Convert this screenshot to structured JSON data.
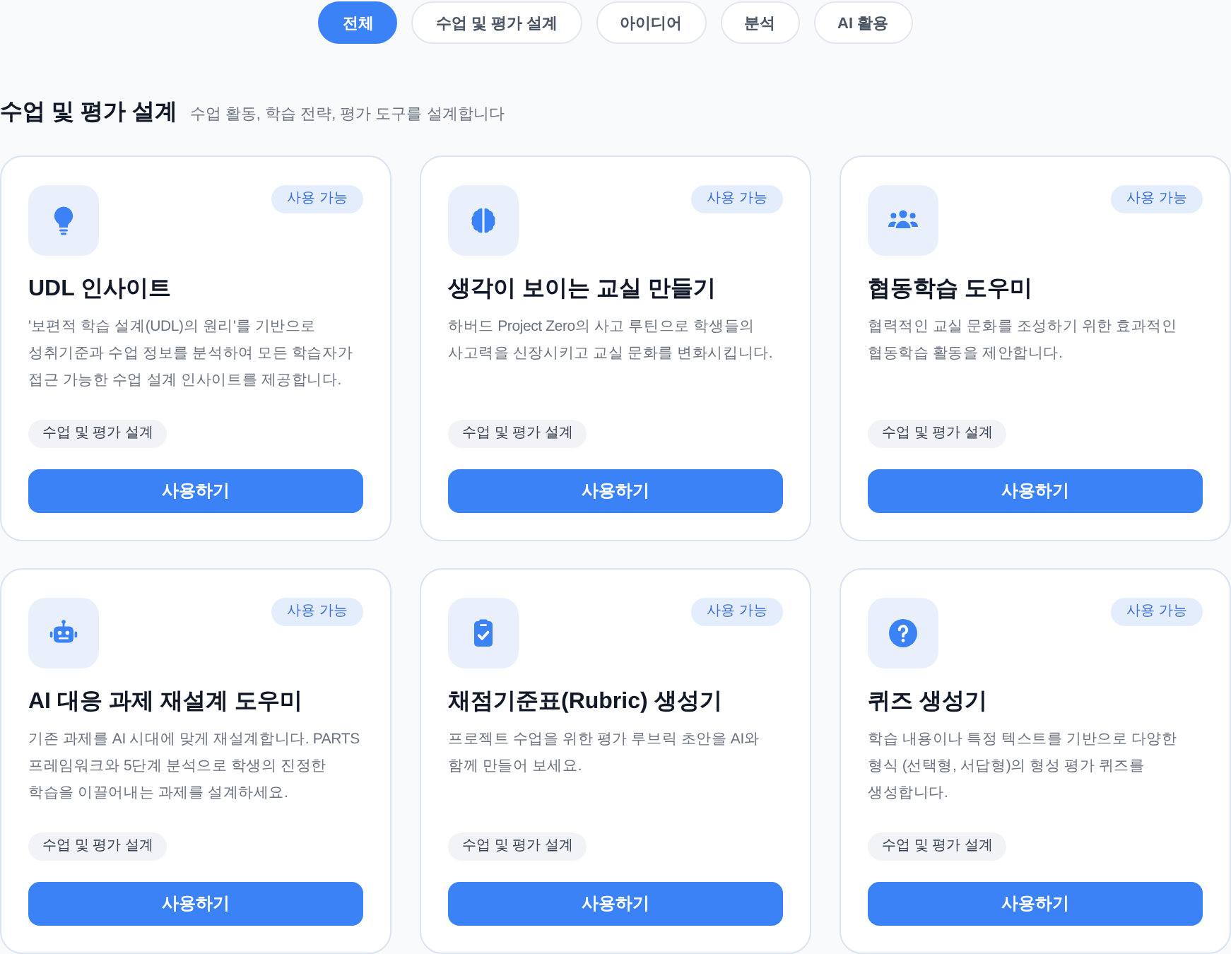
{
  "filter_tabs": [
    {
      "label": "전체",
      "selected": true
    },
    {
      "label": "수업 및 평가 설계",
      "selected": false
    },
    {
      "label": "아이디어",
      "selected": false
    },
    {
      "label": "분석",
      "selected": false
    },
    {
      "label": "AI 활용",
      "selected": false
    }
  ],
  "section": {
    "title": "수업 및 평가 설계",
    "subtitle": "수업 활동, 학습 전략, 평가 도구를 설계합니다"
  },
  "cards": [
    {
      "badge": "사용 가능",
      "title": "UDL 인사이트",
      "description": "'보편적 학습 설계(UDL)의 원리'를 기반으로 성취기준과 수업 정보를 분석하여 모든 학습자가 접근 가능한 수업 설계 인사이트를 제공합니다.",
      "tag": "수업 및 평가 설계",
      "button": "사용하기"
    },
    {
      "badge": "사용 가능",
      "title": "생각이 보이는 교실 만들기",
      "description": "하버드 Project Zero의 사고 루틴으로 학생들의 사고력을 신장시키고 교실 문화를 변화시킵니다.",
      "tag": "수업 및 평가 설계",
      "button": "사용하기"
    },
    {
      "badge": "사용 가능",
      "title": "협동학습 도우미",
      "description": "협력적인 교실 문화를 조성하기 위한 효과적인 협동학습 활동을 제안합니다.",
      "tag": "수업 및 평가 설계",
      "button": "사용하기"
    },
    {
      "badge": "사용 가능",
      "title": "AI 대응 과제 재설계 도우미",
      "description": "기존 과제를 AI 시대에 맞게 재설계합니다. PARTS 프레임워크와 5단계 분석으로 학생의 진정한 학습을 이끌어내는 과제를 설계하세요.",
      "tag": "수업 및 평가 설계",
      "button": "사용하기"
    },
    {
      "badge": "사용 가능",
      "title": "채점기준표(Rubric) 생성기",
      "description": "프로젝트 수업을 위한 평가 루브릭 초안을 AI와 함께 만들어 보세요.",
      "tag": "수업 및 평가 설계",
      "button": "사용하기"
    },
    {
      "badge": "사용 가능",
      "title": "퀴즈 생성기",
      "description": "학습 내용이나 특정 텍스트를 기반으로 다양한 형식 (선택형, 서답형)의 형성 평가 퀴즈를 생성합니다.",
      "tag": "수업 및 평가 설계",
      "button": "사용하기"
    }
  ]
}
